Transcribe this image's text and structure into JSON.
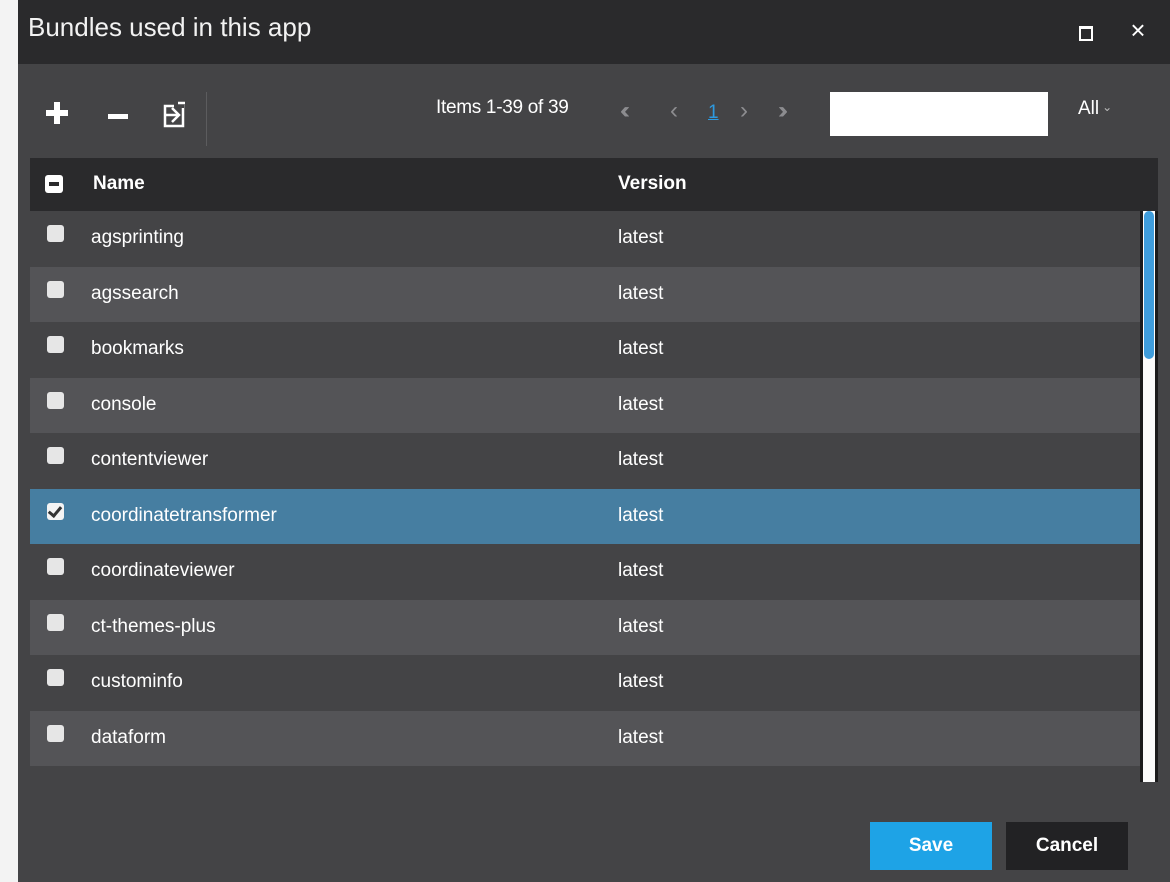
{
  "dialog": {
    "title": "Bundles used in this app"
  },
  "toolbar": {
    "add_icon": "plus-icon",
    "remove_icon": "minus-icon",
    "export_icon": "export-icon"
  },
  "pager": {
    "info": "Items 1-39 of 39",
    "first": "«",
    "prev": "‹",
    "current_page": "1",
    "next": "›",
    "last": "»"
  },
  "search": {
    "value": "",
    "placeholder": ""
  },
  "filter": {
    "selected": "All"
  },
  "grid": {
    "columns": {
      "name": "Name",
      "version": "Version"
    },
    "rows": [
      {
        "name": "agsprinting",
        "version": "latest",
        "checked": false
      },
      {
        "name": "agssearch",
        "version": "latest",
        "checked": false
      },
      {
        "name": "bookmarks",
        "version": "latest",
        "checked": false
      },
      {
        "name": "console",
        "version": "latest",
        "checked": false
      },
      {
        "name": "contentviewer",
        "version": "latest",
        "checked": false
      },
      {
        "name": "coordinatetransformer",
        "version": "latest",
        "checked": true
      },
      {
        "name": "coordinateviewer",
        "version": "latest",
        "checked": false
      },
      {
        "name": "ct-themes-plus",
        "version": "latest",
        "checked": false
      },
      {
        "name": "custominfo",
        "version": "latest",
        "checked": false
      },
      {
        "name": "dataform",
        "version": "latest",
        "checked": false
      }
    ]
  },
  "footer": {
    "save_label": "Save",
    "cancel_label": "Cancel"
  },
  "colors": {
    "selected_row": "#467ea1",
    "accent": "#1ea3e6",
    "link": "#2d9ae0"
  }
}
